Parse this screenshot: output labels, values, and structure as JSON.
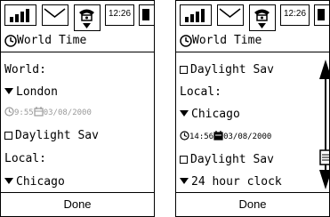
{
  "colors": {
    "foreground": "#000000",
    "background": "#ffffff",
    "disabled": "#9a9a9a"
  },
  "status_bar": {
    "time": "12:26",
    "icons": [
      "signal-strength-icon",
      "mail-icon",
      "phone-icon",
      "battery-icon"
    ]
  },
  "left_screen": {
    "title": "World Time",
    "world_label": "World:",
    "world_city": "London",
    "world_time": "9:55",
    "world_date": "03/08/2000",
    "world_daylight": "Daylight Sav",
    "local_label": "Local:",
    "local_city": "Chicago",
    "done": "Done",
    "scroll_position": 0.2
  },
  "right_screen": {
    "title": "World Time",
    "world_daylight": "Daylight Sav",
    "local_label": "Local:",
    "local_city": "Chicago",
    "local_time": "14:56",
    "local_date": "03/08/2000",
    "local_daylight": "Daylight Sav",
    "clock_format": "24 hour clock",
    "done": "Done",
    "scroll_position": 0.9
  }
}
